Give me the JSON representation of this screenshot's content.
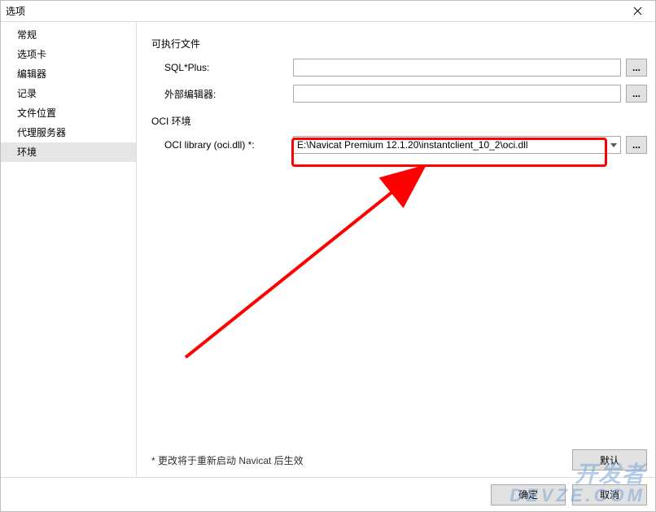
{
  "window": {
    "title": "选项"
  },
  "sidebar": {
    "items": [
      {
        "label": "常规"
      },
      {
        "label": "选项卡"
      },
      {
        "label": "编辑器"
      },
      {
        "label": "记录"
      },
      {
        "label": "文件位置"
      },
      {
        "label": "代理服务器"
      },
      {
        "label": "环境"
      }
    ],
    "selectedIndex": 6
  },
  "main": {
    "section_exec": "可执行文件",
    "sqlplus_label": "SQL*Plus:",
    "sqlplus_value": "",
    "external_editor_label": "外部编辑器:",
    "external_editor_value": "",
    "section_oci": "OCI 环境",
    "oci_label": "OCI library (oci.dll) *:",
    "oci_value": "E:\\Navicat Premium 12.1.20\\instantclient_10_2\\oci.dll",
    "browse_label": "...",
    "hint": "* 更改将于重新启动 Navicat 后生效"
  },
  "buttons": {
    "default": "默认",
    "ok": "确定",
    "cancel": "取消"
  },
  "watermark": {
    "line1": "开发者",
    "line2": "DEVZE.COM"
  }
}
